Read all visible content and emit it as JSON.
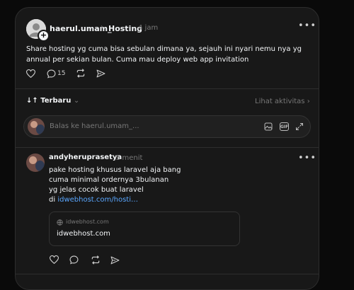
{
  "post": {
    "author": "haerul.umam_",
    "community": "Hosting",
    "time": "4 jam",
    "text": "Share hosting yg cuma bisa sebulan dimana ya, sejauh ini nyari nemu nya yg annual per sekian bulan. Cuma mau deploy web app invitation",
    "reply_count": "15"
  },
  "sort": {
    "label": "Terbaru",
    "activity_link": "Lihat aktivitas"
  },
  "reply_input": {
    "placeholder": "Balas ke haerul.umam_..."
  },
  "comment": {
    "author": "andyheruprasetya",
    "time": "1 menit",
    "lines": [
      "pake hosting khusus laravel aja bang",
      "cuma minimal ordernya 3bulanan",
      "yg jelas cocok buat laravel"
    ],
    "link_prefix": "di ",
    "link_text": "idwebhost.com/hosti…",
    "preview": {
      "domain": "idwebhost.com",
      "title": "idwebhost.com"
    }
  },
  "colors": {
    "background": "#0a0a0a",
    "card": "#181818",
    "text": "#f3f5f7",
    "muted": "#777777",
    "link": "#5aa7ff",
    "border": "#2d2d2d"
  },
  "icons": [
    "plus-icon",
    "chevron-right-icon",
    "more-icon",
    "heart-icon",
    "comment-icon",
    "repost-icon",
    "share-icon",
    "sort-icon",
    "chevron-down-icon",
    "gif-icon",
    "image-icon",
    "expand-icon",
    "globe-icon"
  ]
}
